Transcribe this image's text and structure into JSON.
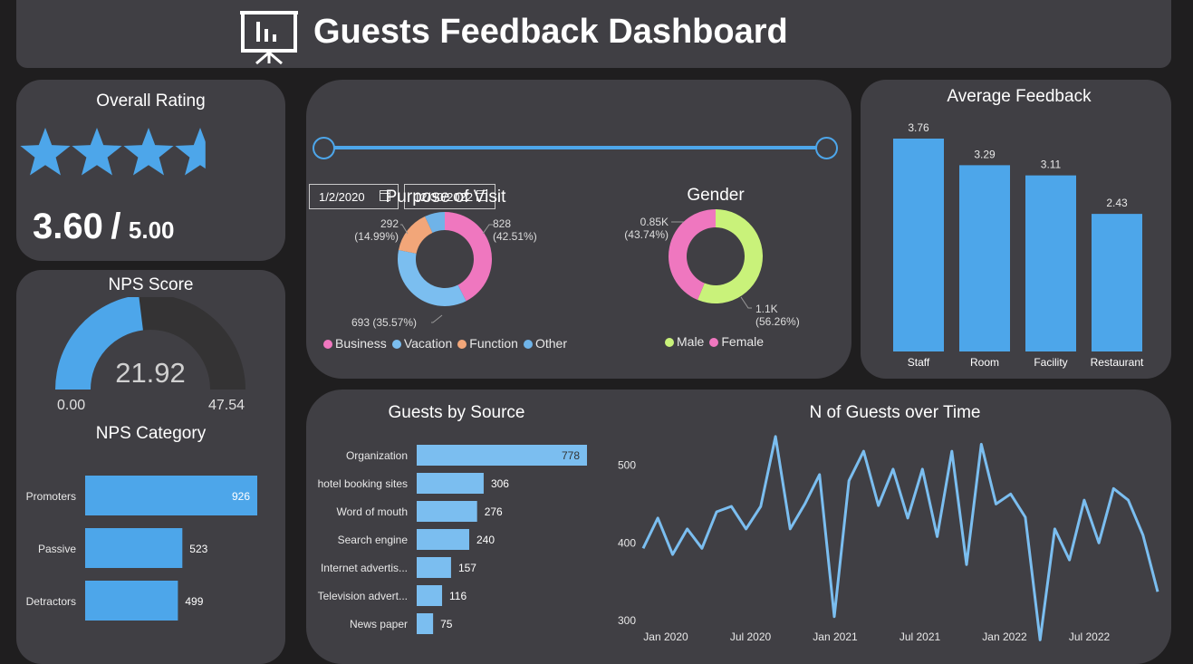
{
  "header": {
    "title": "Guests Feedback Dashboard",
    "icon": "presentation-chart-icon"
  },
  "overall_rating": {
    "title": "Overall Rating",
    "stars_value": 3.6,
    "stars_max": 5,
    "score": "3.60",
    "separator": "/",
    "max": "5.00",
    "star_color": "#4da6ea"
  },
  "nps_score": {
    "title": "NPS Score",
    "value": "21.92",
    "min": "0.00",
    "max": "47.54",
    "fraction": 0.461
  },
  "nps_category": {
    "title": "NPS Category",
    "chart_data": {
      "type": "bar",
      "orientation": "horizontal",
      "categories": [
        "Promoters",
        "Passive",
        "Detractors"
      ],
      "values": [
        926,
        523,
        499
      ],
      "color": "#4da6ea"
    }
  },
  "date_filter": {
    "start": "1/2/2020",
    "end": "12/30/2022",
    "icon": "calendar-icon"
  },
  "purpose_of_visit": {
    "title": "Purpose of Visit",
    "chart_data": {
      "type": "pie",
      "donut": true,
      "categories": [
        "Business",
        "Vacation",
        "Function",
        "Other"
      ],
      "values": [
        828,
        693,
        292,
        135
      ],
      "colors": [
        "#ef77bf",
        "#7bbef0",
        "#f2a679",
        "#6fb3e8"
      ],
      "labels": [
        {
          "value": "828",
          "pct": "(42.51%)"
        },
        {
          "value": "693 (35.57%)",
          "pct": ""
        },
        {
          "value": "292",
          "pct": "(14.99%)"
        }
      ]
    }
  },
  "gender": {
    "title": "Gender",
    "chart_data": {
      "type": "pie",
      "donut": true,
      "categories": [
        "Male",
        "Female"
      ],
      "values": [
        56.26,
        43.74
      ],
      "colors": [
        "#c9f27a",
        "#ef77bf"
      ],
      "labels": [
        {
          "value": "1.1K",
          "pct": "(56.26%)"
        },
        {
          "value": "0.85K",
          "pct": "(43.74%)"
        }
      ]
    }
  },
  "average_feedback": {
    "title": "Average Feedback",
    "chart_data": {
      "type": "bar",
      "categories": [
        "Staff",
        "Room",
        "Facility",
        "Restaurant"
      ],
      "values": [
        3.76,
        3.29,
        3.11,
        2.43
      ],
      "labels": [
        "3.76",
        "3.29",
        "3.11",
        "2.43"
      ],
      "color": "#4da6ea"
    }
  },
  "guests_by_source": {
    "title": "Guests by Source",
    "chart_data": {
      "type": "bar",
      "orientation": "horizontal",
      "categories": [
        "Organization",
        "hotel booking sites",
        "Word of mouth",
        "Search engine",
        "Internet advertis...",
        "Television advert...",
        "News paper"
      ],
      "values": [
        778,
        306,
        276,
        240,
        157,
        116,
        75
      ],
      "color": "#7bbef0"
    }
  },
  "guests_over_time": {
    "title": "N of Guests over Time",
    "chart_data": {
      "type": "line",
      "x_ticks": [
        "Jan 2020",
        "Jul 2020",
        "Jan 2021",
        "Jul 2021",
        "Jan 2022",
        "Jul 2022"
      ],
      "y_ticks": [
        "500",
        "400",
        "300"
      ],
      "ylim": [
        265,
        545
      ],
      "values": [
        393,
        432,
        385,
        418,
        393,
        440,
        447,
        418,
        447,
        537,
        418,
        450,
        488,
        305,
        480,
        518,
        448,
        495,
        432,
        495,
        408,
        518,
        372,
        527,
        450,
        463,
        433,
        275,
        418,
        378,
        455,
        400,
        470,
        455,
        410,
        337
      ],
      "color": "#7bbef0"
    }
  }
}
